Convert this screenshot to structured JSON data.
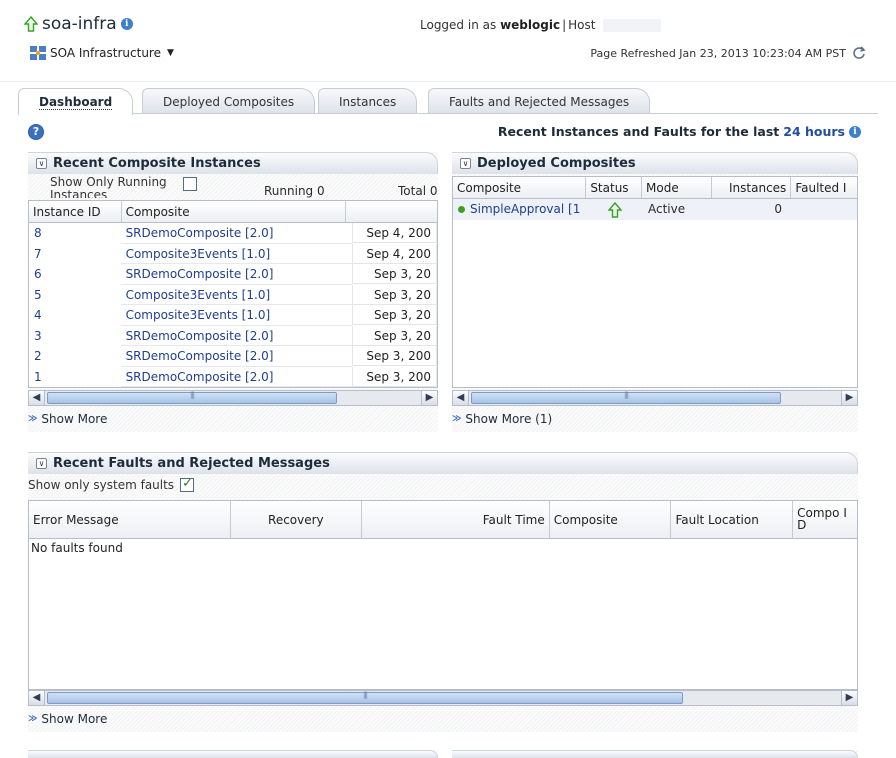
{
  "header": {
    "app_title": "soa-infra",
    "target_menu_label": "SOA Infrastructure",
    "logged_in_prefix": "Logged in as",
    "user": "weblogic",
    "host_label": "Host",
    "page_refreshed": "Page Refreshed Jan 23, 2013 10:23:04 AM PST"
  },
  "tabs": [
    {
      "label": "Dashboard",
      "active": true
    },
    {
      "label": "Deployed Composites",
      "active": false
    },
    {
      "label": "Instances",
      "active": false
    },
    {
      "label": "Faults and Rejected Messages",
      "active": false
    }
  ],
  "range": {
    "prefix": "Recent Instances and Faults for the last",
    "link": "24 hours"
  },
  "recent_instances": {
    "title": "Recent Composite Instances",
    "show_running_label": "Show Only Running Instances",
    "show_running_checked": false,
    "running": "Running 0",
    "total": "Total 0",
    "columns": [
      "Instance ID",
      "Composite",
      ""
    ],
    "rows": [
      {
        "id": "8",
        "composite": "SRDemoComposite [2.0]",
        "date": "Sep 4, 200"
      },
      {
        "id": "7",
        "composite": "Composite3Events [1.0]",
        "date": "Sep 4, 200"
      },
      {
        "id": "6",
        "composite": "SRDemoComposite [2.0]",
        "date": "Sep 3, 20"
      },
      {
        "id": "5",
        "composite": "Composite3Events [1.0]",
        "date": "Sep 3, 20"
      },
      {
        "id": "4",
        "composite": "Composite3Events [1.0]",
        "date": "Sep 3, 20"
      },
      {
        "id": "3",
        "composite": "SRDemoComposite [2.0]",
        "date": "Sep 3, 20"
      },
      {
        "id": "2",
        "composite": "SRDemoComposite [2.0]",
        "date": "Sep 3, 200"
      },
      {
        "id": "1",
        "composite": "SRDemoComposite [2.0]",
        "date": "Sep 3, 200"
      }
    ],
    "show_more": "Show More"
  },
  "deployed_composites": {
    "title": "Deployed Composites",
    "columns": [
      "Composite",
      "Status",
      "Mode",
      "Instances",
      "Faulted I"
    ],
    "rows": [
      {
        "composite": "SimpleApproval [1",
        "status": "up-arrow-icon",
        "mode": "Active",
        "instances": "0"
      }
    ],
    "show_more": "Show More (1)"
  },
  "faults": {
    "title": "Recent Faults and Rejected Messages",
    "system_faults_label": "Show only system faults",
    "system_faults_checked": true,
    "columns": [
      "Error Message",
      "Recovery",
      "Fault Time",
      "Composite",
      "Fault Location",
      "Compo ID"
    ],
    "empty_text": "No faults found",
    "show_more": "Show More"
  },
  "colors": {
    "link": "#1f3f8b",
    "status_green": "#3aa02a",
    "tab_border": "#c7cdd6"
  }
}
